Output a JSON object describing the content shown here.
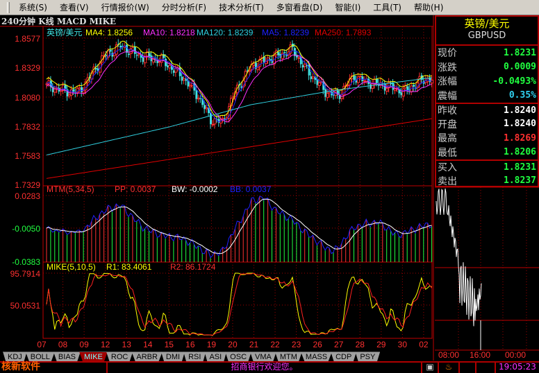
{
  "menu": [
    "系统(S)",
    "查看(V)",
    "行情报价(W)",
    "分时分析(F)",
    "技术分析(T)",
    "多窗看盘(D)",
    "智能(I)",
    "工具(T)",
    "帮助(H)"
  ],
  "chart_title": "240分钟 K线 MACD MIKE",
  "legend": {
    "name": "英镑/美元",
    "ma4": "MA4: 1.8256",
    "ma10": "MA10: 1.8218",
    "ma120": "MA120: 1.8239",
    "ma5": "MA5: 1.8239",
    "ma250": "MA250: 1.7893"
  },
  "price_axis": [
    "1.8577",
    "1.8329",
    "1.8080",
    "1.7832",
    "1.7583",
    "1.7329"
  ],
  "mtm": {
    "title": "MTM(5,34,5)",
    "pp": "PP: 0.0037",
    "bw": "BW: -0.0002",
    "bb": "BB: 0.0037",
    "axis": [
      "0.0283",
      "-0.0050",
      "-0.0383"
    ]
  },
  "mike": {
    "title": "MIKE(5,10,5)",
    "r1": "R1: 83.4061",
    "r2": "R2: 86.1724",
    "axis": [
      "95.7914",
      "50.0531"
    ]
  },
  "dates": [
    "07",
    "08",
    "09",
    "12",
    "13",
    "14",
    "15",
    "16",
    "19",
    "20",
    "21",
    "22",
    "23",
    "26",
    "27",
    "28",
    "29",
    "30",
    "02"
  ],
  "colors": {
    "up": "#ff3030",
    "down": "#40e0e0",
    "ma4": "#ffff00",
    "ma10": "#ff30ff",
    "ma5": "#2020ff",
    "ma120": "#30d0e0",
    "ma250": "#e00000"
  },
  "chart_data": {
    "type": "candlestick",
    "ylim": [
      1.7329,
      1.8577
    ],
    "keypoints": [
      [
        0,
        1.817
      ],
      [
        10,
        1.812
      ],
      [
        16,
        1.812
      ],
      [
        22,
        1.827
      ],
      [
        28,
        1.842
      ],
      [
        36,
        1.851
      ],
      [
        46,
        1.842
      ],
      [
        56,
        1.839
      ],
      [
        66,
        1.825
      ],
      [
        74,
        1.808
      ],
      [
        80,
        1.788
      ],
      [
        86,
        1.786
      ],
      [
        92,
        1.812
      ],
      [
        100,
        1.834
      ],
      [
        112,
        1.842
      ],
      [
        120,
        1.848
      ],
      [
        126,
        1.832
      ],
      [
        136,
        1.812
      ],
      [
        142,
        1.808
      ],
      [
        150,
        1.825
      ],
      [
        156,
        1.82
      ],
      [
        166,
        1.817
      ],
      [
        174,
        1.812
      ],
      [
        184,
        1.822
      ],
      [
        188,
        1.823
      ]
    ],
    "ma250_range": [
      1.738,
      1.789
    ],
    "ma120_points": [
      [
        0,
        1.758
      ],
      [
        60,
        1.782
      ],
      [
        100,
        1.801
      ],
      [
        140,
        1.813
      ],
      [
        188,
        1.824
      ]
    ]
  },
  "quote": {
    "name": "英镑/美元",
    "code": "GBPUSD",
    "rows": [
      {
        "label": "现价",
        "value": "1.8231",
        "color": "#20ff40"
      },
      {
        "label": "涨跌",
        "value": "0.0009",
        "color": "#20ff40"
      },
      {
        "label": "涨幅",
        "value": "-0.0493%",
        "color": "#20ff40"
      },
      {
        "label": "震幅",
        "value": "0.35%",
        "color": "#30d0f0"
      },
      {
        "label": "昨收",
        "value": "1.8240",
        "color": "#ffffff"
      },
      {
        "label": "开盘",
        "value": "1.8240",
        "color": "#ffffff"
      },
      {
        "label": "最高",
        "value": "1.8269",
        "color": "#ff3030"
      },
      {
        "label": "最低",
        "value": "1.8206",
        "color": "#20ff40"
      },
      {
        "label": "买入",
        "value": "1.8231",
        "color": "#20ff40"
      },
      {
        "label": "卖出",
        "value": "1.8237",
        "color": "#20ff40"
      }
    ]
  },
  "mini_times": [
    "08:00",
    "16:00",
    "00:00"
  ],
  "tabs": [
    "KDJ",
    "BOLL",
    "BIAS",
    "MIKE",
    "ROC",
    "ARBR",
    "DMI",
    "RSI",
    "ASI",
    "OSC",
    "VMA",
    "MTM",
    "MASS",
    "CDP",
    "PSY"
  ],
  "active_tab": "MIKE",
  "status": {
    "brand": "核新软件",
    "message": "招商银行欢迎您。",
    "time": "19:05:23"
  }
}
